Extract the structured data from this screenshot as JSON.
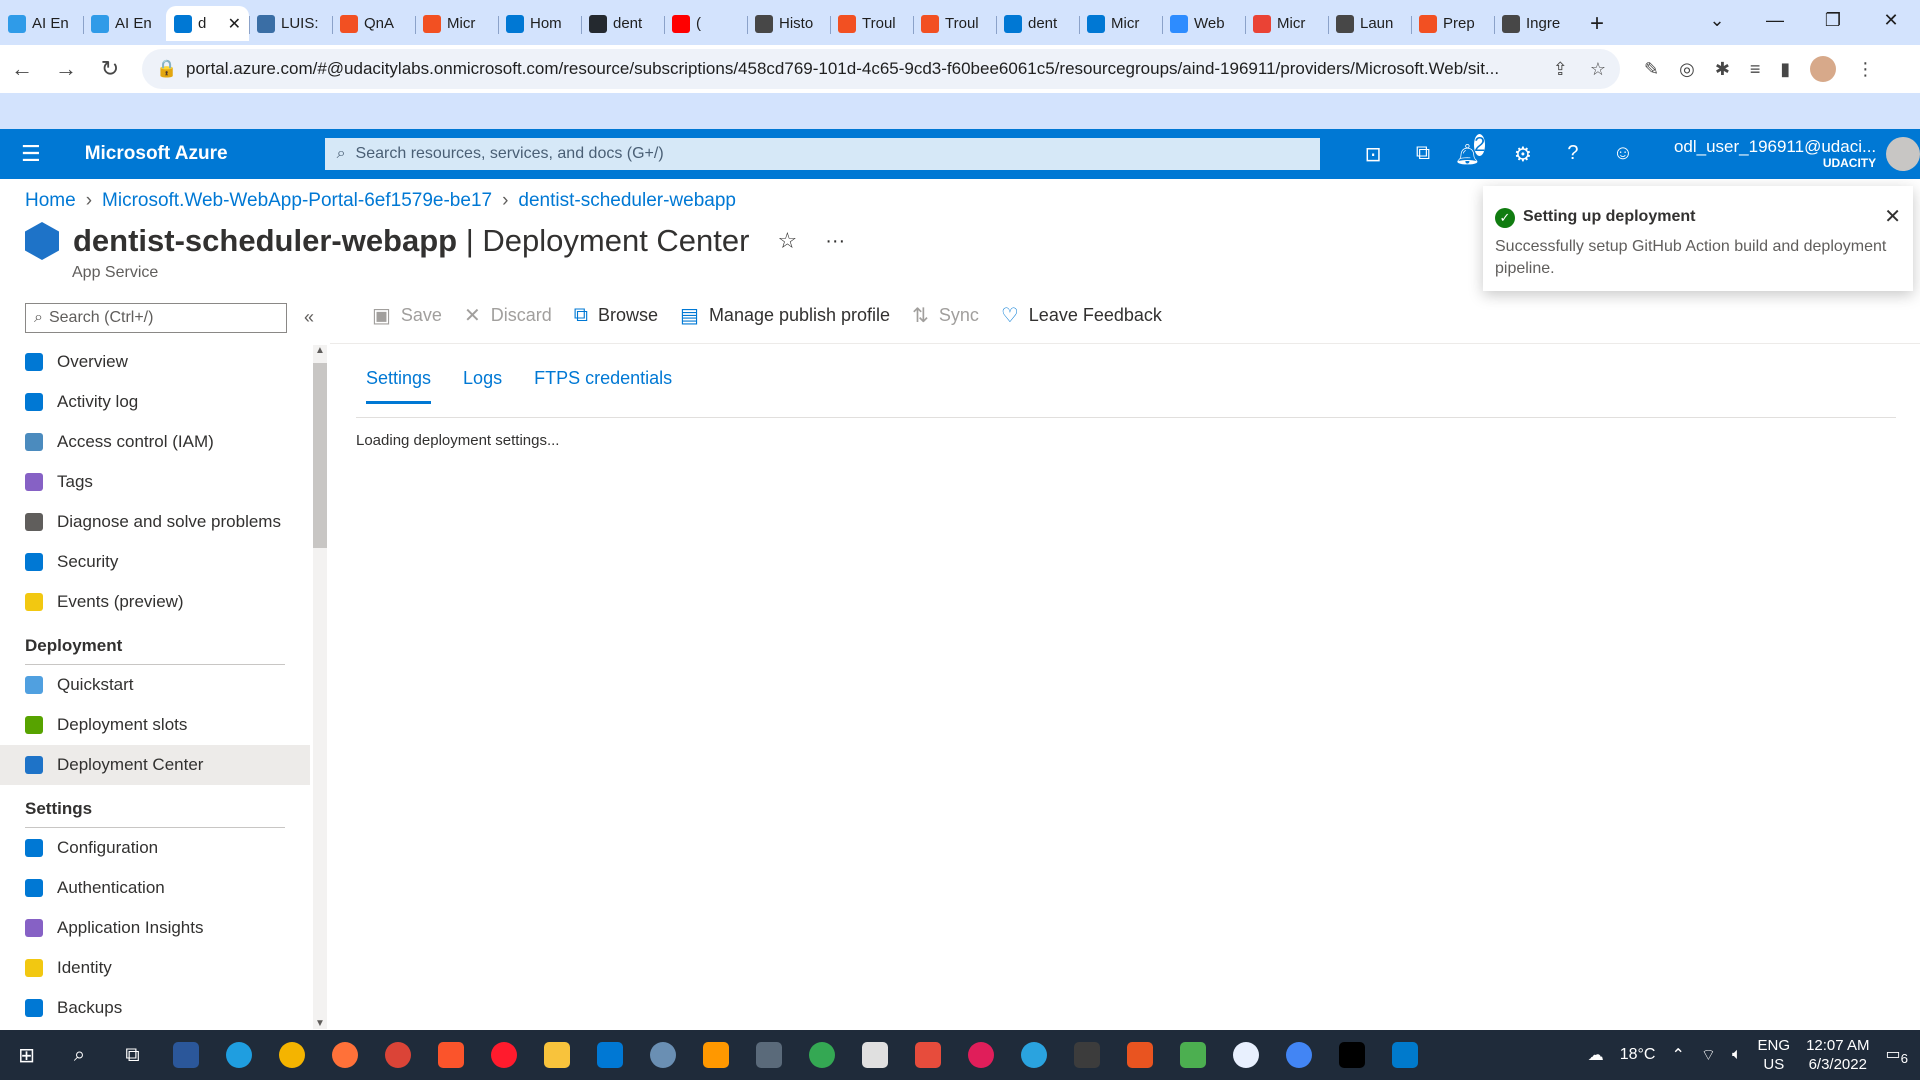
{
  "browser": {
    "tabs": [
      {
        "label": "AI En",
        "color": "#2f9be8"
      },
      {
        "label": "AI En",
        "color": "#2f9be8"
      },
      {
        "label": "d",
        "color": "#0078d4",
        "active": true
      },
      {
        "label": "LUIS:",
        "color": "#3a6ea5"
      },
      {
        "label": "QnA",
        "color": "#f25022"
      },
      {
        "label": "Micr",
        "color": "#f25022"
      },
      {
        "label": "Hom",
        "color": "#0078d4"
      },
      {
        "label": "dent",
        "color": "#24292f"
      },
      {
        "label": "(",
        "color": "#ff0000"
      },
      {
        "label": "Histo",
        "color": "#474747"
      },
      {
        "label": "Troul",
        "color": "#f25022"
      },
      {
        "label": "Troul",
        "color": "#f25022"
      },
      {
        "label": "dent",
        "color": "#0078d4"
      },
      {
        "label": "Micr",
        "color": "#0078d4"
      },
      {
        "label": "Web",
        "color": "#2d8cff"
      },
      {
        "label": "Micr",
        "color": "#ea4335"
      },
      {
        "label": "Laun",
        "color": "#474747"
      },
      {
        "label": "Prep",
        "color": "#f25022"
      },
      {
        "label": "Ingre",
        "color": "#474747"
      }
    ],
    "url": "portal.azure.com/#@udacitylabs.onmicrosoft.com/resource/subscriptions/458cd769-101d-4c65-9cd3-f60bee6061c5/resourcegroups/aind-196911/providers/Microsoft.Web/sit..."
  },
  "azure": {
    "brand": "Microsoft Azure",
    "search_placeholder": "Search resources, services, and docs (G+/)",
    "notification_count": "2",
    "user_name": "odl_user_196911@udaci...",
    "user_org": "UDACITY"
  },
  "breadcrumb": [
    "Home",
    "Microsoft.Web-WebApp-Portal-6ef1579e-be17",
    "dentist-scheduler-webapp"
  ],
  "page": {
    "title": "dentist-scheduler-webapp",
    "title_suffix": " | Deployment Center",
    "subtitle": "App Service"
  },
  "sidebar": {
    "search_placeholder": "Search (Ctrl+/)",
    "items": [
      {
        "label": "Overview",
        "icon": "globe-icon",
        "color": "#0078d4"
      },
      {
        "label": "Activity log",
        "icon": "log-icon",
        "color": "#0078d4"
      },
      {
        "label": "Access control (IAM)",
        "icon": "people-icon",
        "color": "#4b8bbe"
      },
      {
        "label": "Tags",
        "icon": "tag-icon",
        "color": "#8661c5"
      },
      {
        "label": "Diagnose and solve problems",
        "icon": "wrench-icon",
        "color": "#605e5c"
      },
      {
        "label": "Security",
        "icon": "shield-icon",
        "color": "#0078d4"
      },
      {
        "label": "Events (preview)",
        "icon": "lightning-icon",
        "color": "#f2c811"
      }
    ],
    "deployment_group": "Deployment",
    "deployment_items": [
      {
        "label": "Quickstart",
        "icon": "cloud-icon",
        "color": "#50a0e0"
      },
      {
        "label": "Deployment slots",
        "icon": "slots-icon",
        "color": "#57a300"
      },
      {
        "label": "Deployment Center",
        "icon": "cube-icon",
        "color": "#1e73c8",
        "selected": true
      }
    ],
    "settings_group": "Settings",
    "settings_items": [
      {
        "label": "Configuration",
        "icon": "sliders-icon",
        "color": "#0078d4"
      },
      {
        "label": "Authentication",
        "icon": "person-key-icon",
        "color": "#0078d4"
      },
      {
        "label": "Application Insights",
        "icon": "bulb-icon",
        "color": "#8661c5"
      },
      {
        "label": "Identity",
        "icon": "identity-icon",
        "color": "#f2c811"
      },
      {
        "label": "Backups",
        "icon": "backup-icon",
        "color": "#0078d4"
      }
    ]
  },
  "toolbar": {
    "save": "Save",
    "discard": "Discard",
    "browse": "Browse",
    "manage_publish_profile": "Manage publish profile",
    "sync": "Sync",
    "leave_feedback": "Leave Feedback"
  },
  "tabs": {
    "settings": "Settings",
    "logs": "Logs",
    "ftps": "FTPS credentials"
  },
  "loading_text": "Loading deployment settings...",
  "toast": {
    "title": "Setting up deployment",
    "message": "Successfully setup GitHub Action build and deployment pipeline."
  },
  "taskbar": {
    "weather": "18°C",
    "lang": "ENG",
    "region": "US",
    "time": "12:07 AM",
    "date": "6/3/2022",
    "notifications": "6"
  }
}
